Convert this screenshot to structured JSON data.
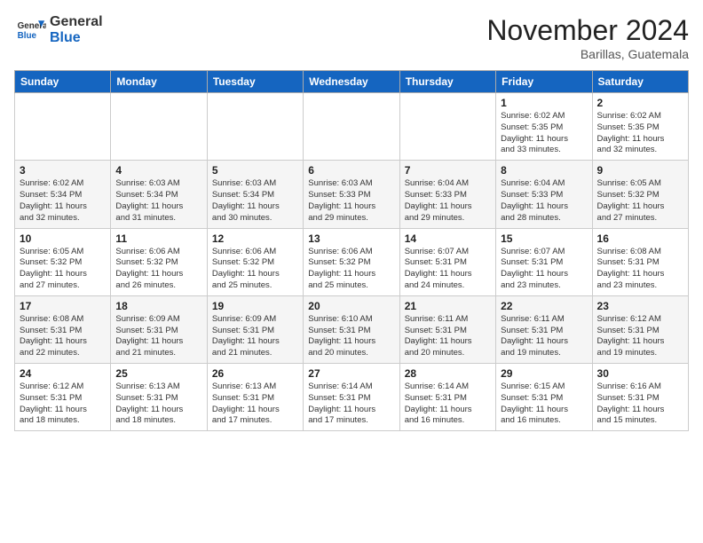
{
  "logo": {
    "general": "General",
    "blue": "Blue"
  },
  "header": {
    "month": "November 2024",
    "location": "Barillas, Guatemala"
  },
  "weekdays": [
    "Sunday",
    "Monday",
    "Tuesday",
    "Wednesday",
    "Thursday",
    "Friday",
    "Saturday"
  ],
  "weeks": [
    [
      {
        "day": "",
        "info": ""
      },
      {
        "day": "",
        "info": ""
      },
      {
        "day": "",
        "info": ""
      },
      {
        "day": "",
        "info": ""
      },
      {
        "day": "",
        "info": ""
      },
      {
        "day": "1",
        "info": "Sunrise: 6:02 AM\nSunset: 5:35 PM\nDaylight: 11 hours\nand 33 minutes."
      },
      {
        "day": "2",
        "info": "Sunrise: 6:02 AM\nSunset: 5:35 PM\nDaylight: 11 hours\nand 32 minutes."
      }
    ],
    [
      {
        "day": "3",
        "info": "Sunrise: 6:02 AM\nSunset: 5:34 PM\nDaylight: 11 hours\nand 32 minutes."
      },
      {
        "day": "4",
        "info": "Sunrise: 6:03 AM\nSunset: 5:34 PM\nDaylight: 11 hours\nand 31 minutes."
      },
      {
        "day": "5",
        "info": "Sunrise: 6:03 AM\nSunset: 5:34 PM\nDaylight: 11 hours\nand 30 minutes."
      },
      {
        "day": "6",
        "info": "Sunrise: 6:03 AM\nSunset: 5:33 PM\nDaylight: 11 hours\nand 29 minutes."
      },
      {
        "day": "7",
        "info": "Sunrise: 6:04 AM\nSunset: 5:33 PM\nDaylight: 11 hours\nand 29 minutes."
      },
      {
        "day": "8",
        "info": "Sunrise: 6:04 AM\nSunset: 5:33 PM\nDaylight: 11 hours\nand 28 minutes."
      },
      {
        "day": "9",
        "info": "Sunrise: 6:05 AM\nSunset: 5:32 PM\nDaylight: 11 hours\nand 27 minutes."
      }
    ],
    [
      {
        "day": "10",
        "info": "Sunrise: 6:05 AM\nSunset: 5:32 PM\nDaylight: 11 hours\nand 27 minutes."
      },
      {
        "day": "11",
        "info": "Sunrise: 6:06 AM\nSunset: 5:32 PM\nDaylight: 11 hours\nand 26 minutes."
      },
      {
        "day": "12",
        "info": "Sunrise: 6:06 AM\nSunset: 5:32 PM\nDaylight: 11 hours\nand 25 minutes."
      },
      {
        "day": "13",
        "info": "Sunrise: 6:06 AM\nSunset: 5:32 PM\nDaylight: 11 hours\nand 25 minutes."
      },
      {
        "day": "14",
        "info": "Sunrise: 6:07 AM\nSunset: 5:31 PM\nDaylight: 11 hours\nand 24 minutes."
      },
      {
        "day": "15",
        "info": "Sunrise: 6:07 AM\nSunset: 5:31 PM\nDaylight: 11 hours\nand 23 minutes."
      },
      {
        "day": "16",
        "info": "Sunrise: 6:08 AM\nSunset: 5:31 PM\nDaylight: 11 hours\nand 23 minutes."
      }
    ],
    [
      {
        "day": "17",
        "info": "Sunrise: 6:08 AM\nSunset: 5:31 PM\nDaylight: 11 hours\nand 22 minutes."
      },
      {
        "day": "18",
        "info": "Sunrise: 6:09 AM\nSunset: 5:31 PM\nDaylight: 11 hours\nand 21 minutes."
      },
      {
        "day": "19",
        "info": "Sunrise: 6:09 AM\nSunset: 5:31 PM\nDaylight: 11 hours\nand 21 minutes."
      },
      {
        "day": "20",
        "info": "Sunrise: 6:10 AM\nSunset: 5:31 PM\nDaylight: 11 hours\nand 20 minutes."
      },
      {
        "day": "21",
        "info": "Sunrise: 6:11 AM\nSunset: 5:31 PM\nDaylight: 11 hours\nand 20 minutes."
      },
      {
        "day": "22",
        "info": "Sunrise: 6:11 AM\nSunset: 5:31 PM\nDaylight: 11 hours\nand 19 minutes."
      },
      {
        "day": "23",
        "info": "Sunrise: 6:12 AM\nSunset: 5:31 PM\nDaylight: 11 hours\nand 19 minutes."
      }
    ],
    [
      {
        "day": "24",
        "info": "Sunrise: 6:12 AM\nSunset: 5:31 PM\nDaylight: 11 hours\nand 18 minutes."
      },
      {
        "day": "25",
        "info": "Sunrise: 6:13 AM\nSunset: 5:31 PM\nDaylight: 11 hours\nand 18 minutes."
      },
      {
        "day": "26",
        "info": "Sunrise: 6:13 AM\nSunset: 5:31 PM\nDaylight: 11 hours\nand 17 minutes."
      },
      {
        "day": "27",
        "info": "Sunrise: 6:14 AM\nSunset: 5:31 PM\nDaylight: 11 hours\nand 17 minutes."
      },
      {
        "day": "28",
        "info": "Sunrise: 6:14 AM\nSunset: 5:31 PM\nDaylight: 11 hours\nand 16 minutes."
      },
      {
        "day": "29",
        "info": "Sunrise: 6:15 AM\nSunset: 5:31 PM\nDaylight: 11 hours\nand 16 minutes."
      },
      {
        "day": "30",
        "info": "Sunrise: 6:16 AM\nSunset: 5:31 PM\nDaylight: 11 hours\nand 15 minutes."
      }
    ]
  ]
}
